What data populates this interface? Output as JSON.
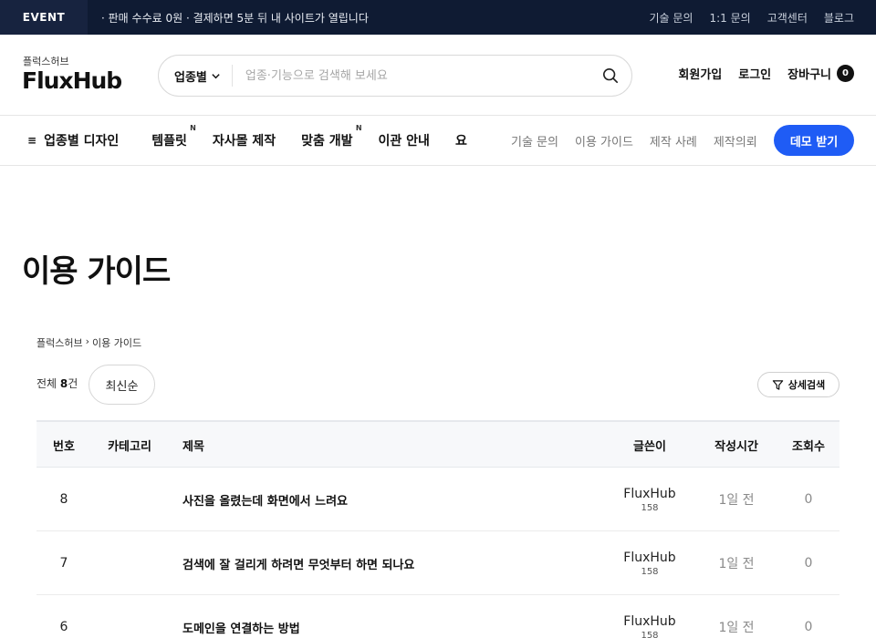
{
  "topbar": {
    "event_label": "EVENT",
    "event_text": "· 판매 수수료 0원 · 결제하면 5분 뒤 내 사이트가 열립니다",
    "links": [
      "기술 문의",
      "1:1 문의",
      "고객센터",
      "블로그"
    ]
  },
  "header": {
    "logo_sub": "플럭스허브",
    "logo": "FluxHub",
    "search": {
      "category": "업종별",
      "placeholder": "업종·기능으로 검색해 보세요"
    },
    "links": {
      "signup": "회원가입",
      "login": "로그인",
      "cart": "장바구니",
      "cart_count": "0"
    }
  },
  "nav": {
    "first": "업종별 디자인",
    "items": [
      {
        "label": "템플릿",
        "sup": "N"
      },
      {
        "label": "자사몰 제작",
        "sup": ""
      },
      {
        "label": "맞춤 개발",
        "sup": "N"
      },
      {
        "label": "이관 안내",
        "sup": ""
      },
      {
        "label": "요",
        "sup": ""
      }
    ],
    "sub_items": [
      "기술 문의",
      "이용 가이드",
      "제작 사례",
      "제작의뢰"
    ],
    "demo_button": "데모 받기"
  },
  "main": {
    "title": "이용 가이드",
    "breadcrumb": [
      "플럭스허브",
      "›",
      "이용 가이드"
    ],
    "total_prefix": "전체 ",
    "total_count": "8",
    "total_suffix": "건",
    "sort_label": "최신순",
    "filter_label": "상세검색",
    "table": {
      "headers": {
        "num": "번호",
        "category": "카테고리",
        "title": "제목",
        "author": "글쓴이",
        "time": "작성시간",
        "views": "조회수"
      },
      "rows": [
        {
          "num": "8",
          "category": "",
          "title": "사진을 올렸는데 화면에서 느려요",
          "author": "FluxHub",
          "author_sub": "158",
          "time": "1일 전",
          "views": "0"
        },
        {
          "num": "7",
          "category": "",
          "title": "검색에 잘 걸리게 하려면 무엇부터 하면 되나요",
          "author": "FluxHub",
          "author_sub": "158",
          "time": "1일 전",
          "views": "0"
        },
        {
          "num": "6",
          "category": "",
          "title": "도메인을 연결하는 방법",
          "author": "FluxHub",
          "author_sub": "158",
          "time": "1일 전",
          "views": "0"
        }
      ]
    }
  }
}
